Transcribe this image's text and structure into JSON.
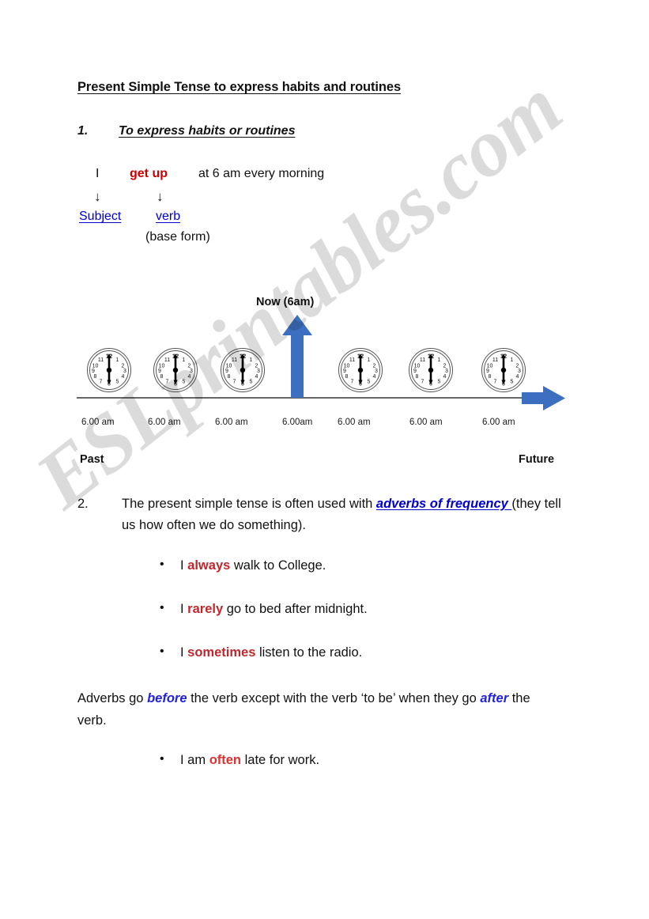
{
  "document": {
    "title": "Present Simple Tense to express habits and routines",
    "watermark": "ESLprintables.com"
  },
  "section_one": {
    "number": "1.",
    "heading": "To express habits or routines",
    "example": {
      "subject_word": "I",
      "verb_word": "get up",
      "rest": "at 6 am every morning",
      "arrow_glyph": "↓",
      "label_subject": "Subject",
      "label_verb": "verb",
      "base_form_note": "(base form)"
    }
  },
  "timeline": {
    "now_label": "Now (6am)",
    "past_label": "Past",
    "future_label": "Future",
    "time_labels": [
      "6.00 am",
      "6.00 am",
      "6.00 am",
      "6.00am",
      "6.00 am",
      "6.00 am",
      "6.00 am"
    ],
    "clock_time": "6 o'clock",
    "clock_numerals": [
      "12",
      "1",
      "2",
      "3",
      "4",
      "5",
      "6",
      "7",
      "8",
      "9",
      "10",
      "11"
    ],
    "arrow_color": "#3C6FBF",
    "axis_color": "#333333"
  },
  "section_two": {
    "number": "2.",
    "text_before": "The present simple tense is often used with ",
    "emphasis": "adverbs of frequency ",
    "text_after": "(they tell us how often we do something).",
    "bullets": [
      {
        "before": "I ",
        "adverb": "always",
        "after": " walk to College."
      },
      {
        "before": "I ",
        "adverb": "rarely",
        "after": " go to bed after midnight."
      },
      {
        "before": "I ",
        "adverb": "sometimes",
        "after": " listen to the radio."
      }
    ]
  },
  "adverb_rule": {
    "part1": "Adverbs go ",
    "em1": "before",
    "part2": " the verb except with the verb ‘to be’ when they go ",
    "em2": "after",
    "part3": " the verb.",
    "bullet": {
      "before": "I am ",
      "adverb": "often",
      "after": " late for work."
    }
  },
  "colors": {
    "red_bright": "#CC0000",
    "red_dark": "#C0272D",
    "link_blue": "#0000CC",
    "arrow_blue": "#3C6FBF"
  }
}
